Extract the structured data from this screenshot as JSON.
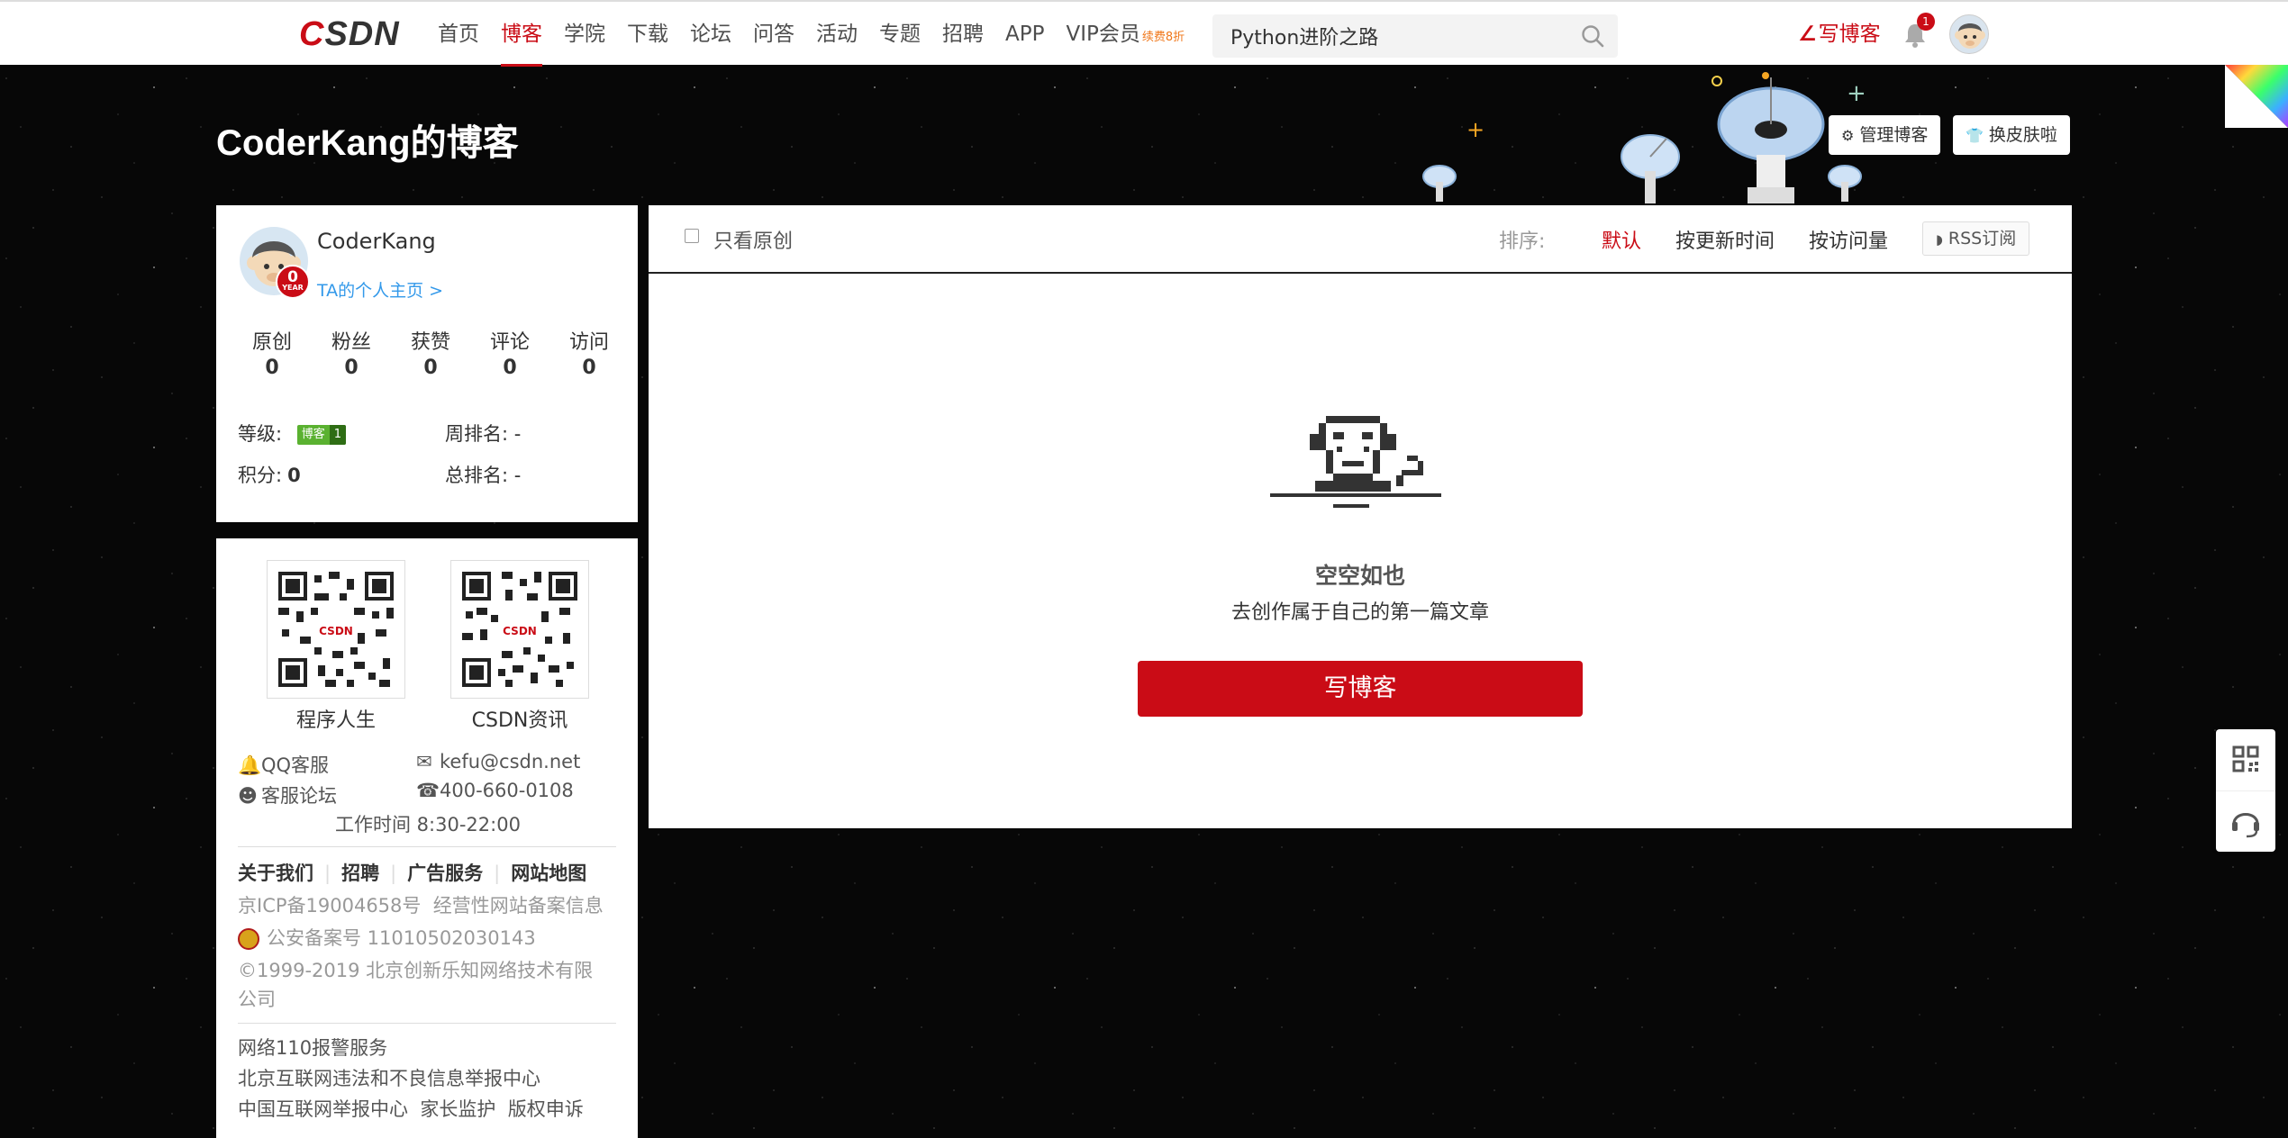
{
  "brand": {
    "logo_text_c": "C",
    "logo_text_rest": "SDN",
    "accent": "#ca0c16"
  },
  "nav": {
    "items": [
      {
        "label": "首页",
        "active": false
      },
      {
        "label": "博客",
        "active": true
      },
      {
        "label": "学院",
        "active": false
      },
      {
        "label": "下载",
        "active": false
      },
      {
        "label": "论坛",
        "active": false
      },
      {
        "label": "问答",
        "active": false
      },
      {
        "label": "活动",
        "active": false
      },
      {
        "label": "专题",
        "active": false
      },
      {
        "label": "招聘",
        "active": false
      },
      {
        "label": "APP",
        "active": false
      },
      {
        "label": "VIP会员",
        "active": false
      }
    ],
    "vip_tag": "续费8折",
    "search_value": "Python进阶之路",
    "write_blog": "写博客",
    "notification_count": "1"
  },
  "blog": {
    "title": "CoderKang的博客",
    "manage_button": "管理博客",
    "skin_button": "换皮肤啦"
  },
  "profile": {
    "username": "CoderKang",
    "year_badge": "0",
    "year_badge_sub": "YEAR",
    "homepage_link": "TA的个人主页 >",
    "stats": [
      {
        "label": "原创",
        "value": "0"
      },
      {
        "label": "粉丝",
        "value": "0"
      },
      {
        "label": "获赞",
        "value": "0"
      },
      {
        "label": "评论",
        "value": "0"
      },
      {
        "label": "访问",
        "value": "0"
      }
    ],
    "level_label": "等级:",
    "level_badge_text": "博客",
    "level_badge_num": "1",
    "weekly_rank_label": "周排名:",
    "weekly_rank_value": "-",
    "points_label": "积分:",
    "points_value": "0",
    "total_rank_label": "总排名:",
    "total_rank_value": "-"
  },
  "contact": {
    "qr1_caption": "程序人生",
    "qr2_caption": "CSDN资讯",
    "qq_service": "QQ客服",
    "email": "kefu@csdn.net",
    "forum": "客服论坛",
    "phone": "400-660-0108",
    "hours": "工作时间 8:30-22:00",
    "footer_links": [
      "关于我们",
      "招聘",
      "广告服务",
      "网站地图"
    ],
    "icp": "京ICP备19004658号",
    "icp_extra": "经营性网站备案信息",
    "police": "公安备案号 11010502030143",
    "copyright": "©1999-2019 北京创新乐知网络技术有限",
    "copyright_2": "公司",
    "report_1": "网络110报警服务",
    "report_2": "北京互联网违法和不良信息举报中心",
    "report_3": "中国互联网举报中心",
    "report_4": "家长监护",
    "report_5": "版权申诉"
  },
  "main": {
    "only_original": "只看原创",
    "sort_label": "排序:",
    "sort_default": "默认",
    "sort_time": "按更新时间",
    "sort_views": "按访问量",
    "rss": "RSS订阅",
    "empty_title": "空空如也",
    "empty_sub": "去创作属于自己的第一篇文章",
    "write_button": "写博客"
  },
  "icons": [
    "search-icon",
    "bell-icon",
    "pen-icon",
    "gear-icon",
    "shirt-icon",
    "rss-icon",
    "bell-qq-icon",
    "mail-icon",
    "forum-icon",
    "phone-icon",
    "police-emblem-icon",
    "qr-code-icon",
    "headset-icon"
  ]
}
